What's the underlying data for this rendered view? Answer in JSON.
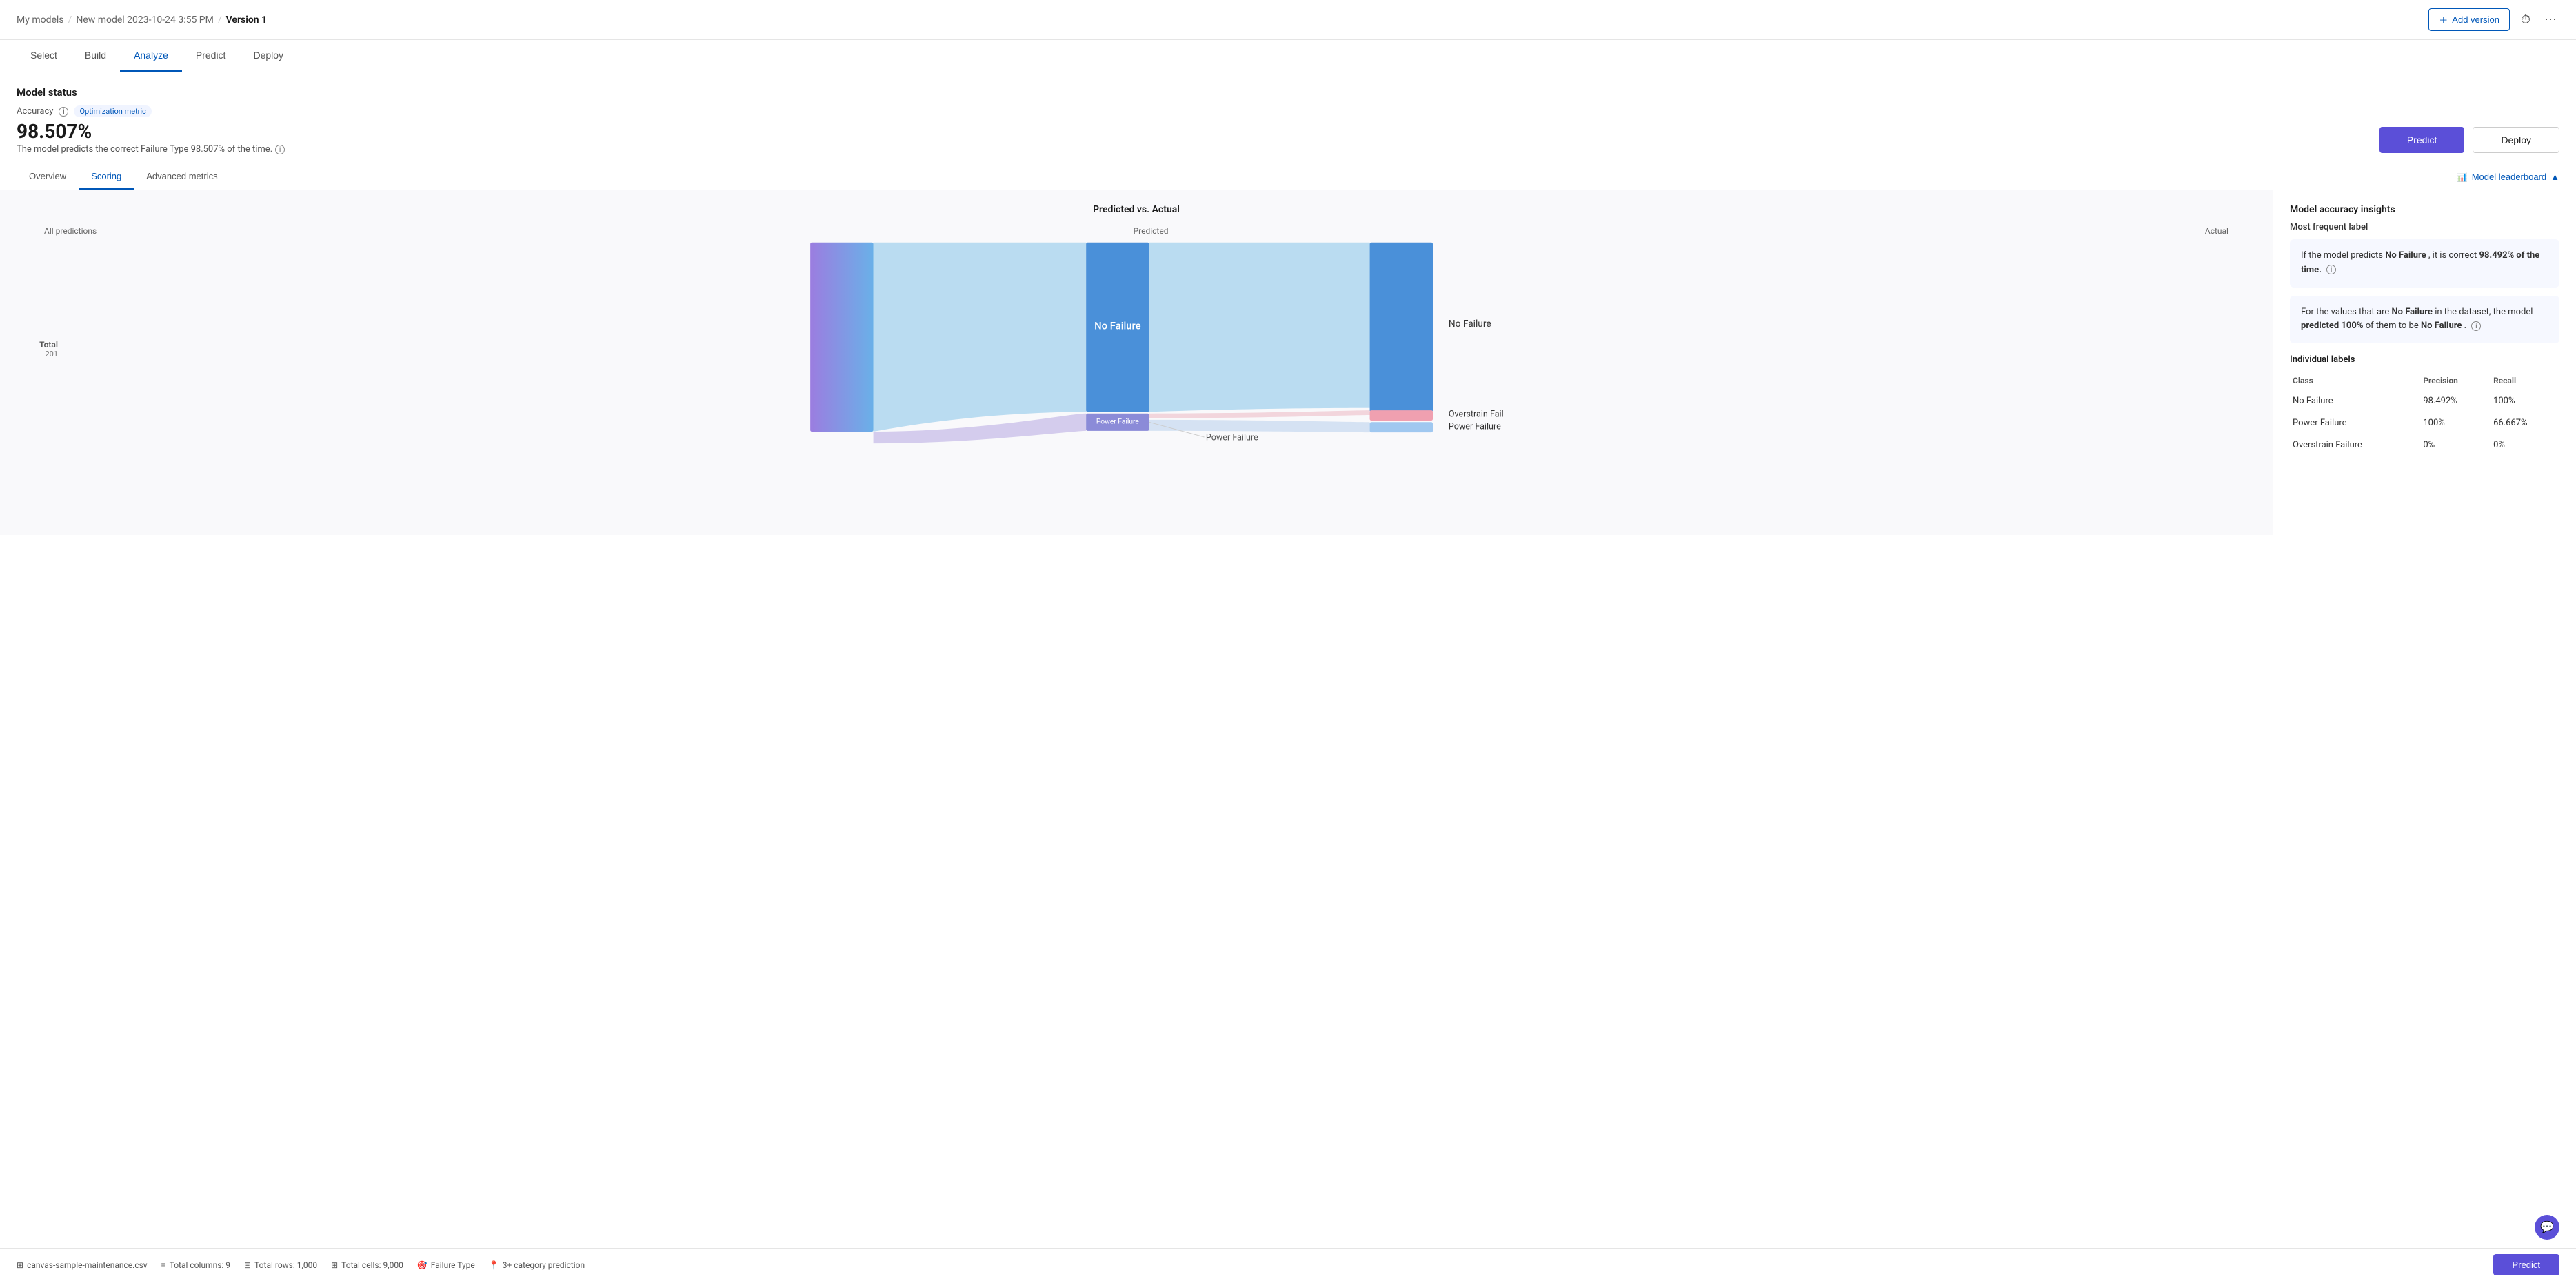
{
  "header": {
    "breadcrumb": "My models / New model 2023-10-24 3:55 PM /",
    "my_models": "My models",
    "sep1": "/",
    "model_name": "New model 2023-10-24 3:55 PM",
    "sep2": "/",
    "version": "Version 1",
    "add_version_label": "Add version",
    "more_icon": "⋯"
  },
  "nav": {
    "tabs": [
      {
        "id": "select",
        "label": "Select"
      },
      {
        "id": "build",
        "label": "Build"
      },
      {
        "id": "analyze",
        "label": "Analyze",
        "active": true
      },
      {
        "id": "predict",
        "label": "Predict"
      },
      {
        "id": "deploy",
        "label": "Deploy"
      }
    ]
  },
  "model_status": {
    "title": "Model status",
    "accuracy_label": "Accuracy",
    "optimization_badge": "Optimization metric",
    "accuracy_value": "98.507%",
    "accuracy_desc": "The model predicts the correct Failure Type 98.507% of the time.",
    "predict_btn": "Predict",
    "deploy_btn": "Deploy"
  },
  "sub_tabs": {
    "tabs": [
      {
        "id": "overview",
        "label": "Overview"
      },
      {
        "id": "scoring",
        "label": "Scoring",
        "active": true
      },
      {
        "id": "advanced",
        "label": "Advanced metrics"
      }
    ],
    "leaderboard_label": "Model leaderboard"
  },
  "chart": {
    "title": "Predicted vs. Actual",
    "col_all": "All predictions",
    "col_predicted": "Predicted",
    "col_actual": "Actual",
    "total_label": "Total",
    "total_value": "201",
    "left_bar_label": "No Failure",
    "left_bar_label_small": "Power Failure",
    "right_bar_no_failure": "No Failure",
    "right_bar_overstrain": "Overstrain Fail",
    "right_bar_power": "Power Failure"
  },
  "right_panel": {
    "insights_title": "Model accuracy insights",
    "frequent_label_title": "Most frequent label",
    "card1": {
      "prefix": "If the model predicts ",
      "label1": "No Failure",
      "middle": ", it is correct ",
      "pct": "98.492% of the time.",
      "suffix": ""
    },
    "card2": {
      "prefix": "For the values that are ",
      "label1": "No Failure",
      "middle": " in the dataset, the model ",
      "label2": "predicted 100%",
      "suffix": " of them to be ",
      "label3": "No Failure",
      "end": "."
    },
    "individual_labels_title": "Individual labels",
    "table": {
      "headers": [
        "Class",
        "Precision",
        "Recall"
      ],
      "rows": [
        {
          "class": "No Failure",
          "precision": "98.492%",
          "recall": "100%"
        },
        {
          "class": "Power Failure",
          "precision": "100%",
          "recall": "66.667%"
        },
        {
          "class": "Overstrain Failure",
          "precision": "0%",
          "recall": "0%"
        }
      ]
    }
  },
  "footer": {
    "file": "canvas-sample-maintenance.csv",
    "columns_label": "Total columns: 9",
    "rows_label": "Total rows: 1,000",
    "cells_label": "Total cells: 9,000",
    "failure_type": "Failure Type",
    "category": "3+ category prediction",
    "predict_btn": "Predict"
  }
}
